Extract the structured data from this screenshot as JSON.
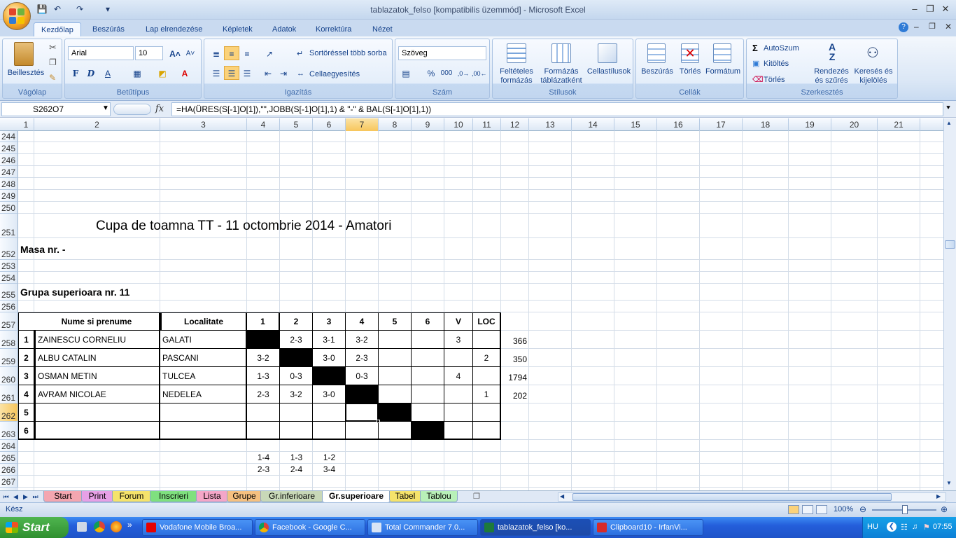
{
  "window": {
    "title": "tablazatok_felso  [kompatibilis üzemmód] - Microsoft Excel"
  },
  "ribbon_tabs": [
    "Kezdőlap",
    "Beszúrás",
    "Lap elrendezése",
    "Képletek",
    "Adatok",
    "Korrektúra",
    "Nézet"
  ],
  "ribbon": {
    "clipboard": {
      "paste": "Beillesztés",
      "label": "Vágólap"
    },
    "font": {
      "name": "Arial",
      "size": "10",
      "bold": "F",
      "italic": "D",
      "underline": "A",
      "label": "Betűtípus"
    },
    "alignment": {
      "wrap": "Sortöréssel több sorba",
      "merge": "Cellaegyesítés",
      "label": "Igazítás"
    },
    "number": {
      "format": "Szöveg",
      "percent": "%",
      "thousands": "000",
      "label": "Szám"
    },
    "styles": {
      "conditional": "Feltételes formázás",
      "as_table": "Formázás táblázatként",
      "cell_styles": "Cellastílusok",
      "label": "Stílusok"
    },
    "cells": {
      "insert": "Beszúrás",
      "delete": "Törlés",
      "format": "Formátum",
      "label": "Cellák"
    },
    "editing": {
      "autosum": "AutoSzum",
      "fill": "Kitöltés",
      "clear": "Törlés",
      "sort": "Rendezés és szűrés",
      "find": "Keresés és kijelölés",
      "label": "Szerkesztés"
    }
  },
  "formula_bar": {
    "name_box": "S262O7",
    "fx": "fx",
    "formula": "=HA(ÜRES(S[-1]O[1]),\"\",JOBB(S[-1]O[1],1) & \"-\" & BAL(S[-1]O[1],1))"
  },
  "column_headers": [
    "1",
    "2",
    "3",
    "4",
    "5",
    "6",
    "7",
    "8",
    "9",
    "10",
    "11",
    "12",
    "13",
    "14",
    "15",
    "16",
    "17",
    "18",
    "19",
    "20",
    "21"
  ],
  "row_headers": [
    "244",
    "245",
    "246",
    "247",
    "248",
    "249",
    "250",
    "251",
    "252",
    "253",
    "254",
    "255",
    "256",
    "257",
    "258",
    "259",
    "260",
    "261",
    "262",
    "263",
    "264",
    "265",
    "266",
    "267"
  ],
  "sheet": {
    "title": "Cupa de toamna TT - 11 octombrie 2014 - Amatori",
    "masa": "Masa nr.  -",
    "group": "Grupa superioara nr. 11",
    "table_header": [
      "Nume si prenume",
      "Localitate",
      "1",
      "2",
      "3",
      "4",
      "5",
      "6",
      "V",
      "LOC"
    ],
    "rows": [
      {
        "nr": "1",
        "name": "ZAINESCU CORNELIU",
        "loc": "GALATI",
        "r": [
          "",
          "2-3",
          "3-1",
          "3-2",
          "",
          ""
        ],
        "v": "3",
        "place": "",
        "side": "366"
      },
      {
        "nr": "2",
        "name": "ALBU CATALIN",
        "loc": "PASCANI",
        "r": [
          "3-2",
          "",
          "3-0",
          "2-3",
          "",
          ""
        ],
        "v": "",
        "place": "2",
        "side": "350"
      },
      {
        "nr": "3",
        "name": "OSMAN METIN",
        "loc": "TULCEA",
        "r": [
          "1-3",
          "0-3",
          "",
          "0-3",
          "",
          ""
        ],
        "v": "4",
        "place": "",
        "side": "1794"
      },
      {
        "nr": "4",
        "name": "AVRAM NICOLAE",
        "loc": "NEDELEA",
        "r": [
          "2-3",
          "3-2",
          "3-0",
          "",
          "",
          ""
        ],
        "v": "",
        "place": "1",
        "side": "202"
      },
      {
        "nr": "5",
        "name": "",
        "loc": "",
        "r": [
          "",
          "",
          "",
          "",
          "",
          ""
        ],
        "v": "",
        "place": "",
        "side": ""
      },
      {
        "nr": "6",
        "name": "",
        "loc": "",
        "r": [
          "",
          "",
          "",
          "",
          "",
          ""
        ],
        "v": "",
        "place": "",
        "side": ""
      }
    ],
    "pairs_row1": [
      "1-4",
      "1-3",
      "1-2"
    ],
    "pairs_row2": [
      "2-3",
      "2-4",
      "3-4"
    ]
  },
  "sheet_tabs": [
    {
      "label": "Start",
      "color": "#f4a6b0"
    },
    {
      "label": "Print",
      "color": "#e6a0e6"
    },
    {
      "label": "Forum",
      "color": "#f5e36b"
    },
    {
      "label": "Inscrieri",
      "color": "#7fe07f"
    },
    {
      "label": "Lista",
      "color": "#f4a6c8"
    },
    {
      "label": "Grupe",
      "color": "#f5c080"
    },
    {
      "label": "Gr.inferioare",
      "color": "#c8d8b8"
    },
    {
      "label": "Gr.superioare",
      "color": "#ffffff"
    },
    {
      "label": "Tabel",
      "color": "#f5e36b"
    },
    {
      "label": "Tablou",
      "color": "#b8f0b8"
    }
  ],
  "status": {
    "ready": "Kész",
    "zoom": "100%"
  },
  "taskbar": {
    "start": "Start",
    "tasks": [
      "Vodafone Mobile Broa...",
      "Facebook - Google C...",
      "Total Commander 7.0...",
      "tablazatok_felso  [ko...",
      "Clipboard10 - IrfanVi..."
    ],
    "lang": "HU",
    "time": "07:55"
  },
  "colors": {
    "accent": "#15428b",
    "selected_header": "#f7c65c",
    "taskbar": "#245edb"
  }
}
